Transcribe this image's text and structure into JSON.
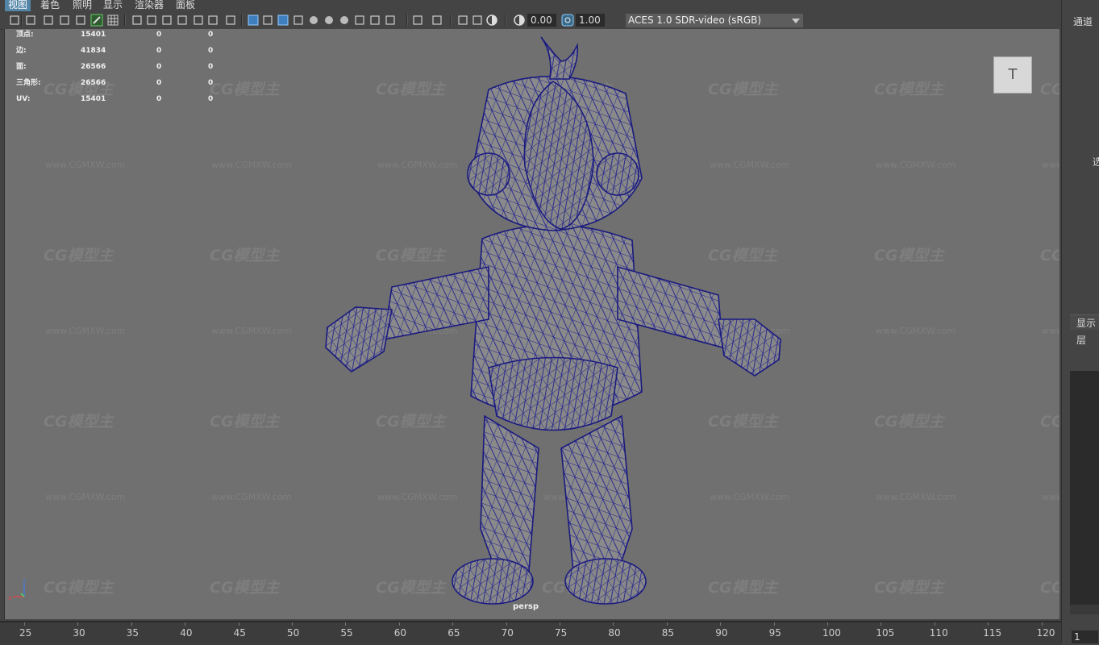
{
  "menu": {
    "items": [
      "视图",
      "着色",
      "照明",
      "显示",
      "渲染器",
      "面板"
    ],
    "active_index": 0
  },
  "toolbar": {
    "exposure_value": "0.00",
    "gamma_value": "1.00",
    "color_space": "ACES 1.0 SDR-video (sRGB)",
    "icons": [
      "camera-select-icon",
      "camera-attributes-icon",
      "bookmark-icon",
      "image-plane-icon",
      "2d-pan-zoom-icon",
      "grease-pencil-icon",
      "grid-icon",
      "film-gate-icon",
      "resolution-gate-icon",
      "gate-mask-icon",
      "field-chart-icon",
      "safe-action-icon",
      "safe-title-icon",
      "wireframe-icon",
      "smooth-shade-icon",
      "default-material-icon",
      "wireframe-on-shaded-icon",
      "xray-icon",
      "use-all-lights-icon",
      "shadows-icon",
      "ambient-occlusion-icon",
      "motion-blur-icon",
      "anti-aliasing-icon",
      "depth-of-field-icon",
      "isolate-select-icon",
      "xray-joints-icon",
      "xray-active-icon",
      "backface-culling-icon",
      "exposure-icon",
      "gamma-icon",
      "color-management-icon"
    ]
  },
  "hud": {
    "rows": [
      {
        "label": "顶点:",
        "value": "15401",
        "col2": "0",
        "col3": "0"
      },
      {
        "label": "边:",
        "value": "41834",
        "col2": "0",
        "col3": "0"
      },
      {
        "label": "面:",
        "value": "26566",
        "col2": "0",
        "col3": "0"
      },
      {
        "label": "三角形:",
        "value": "26566",
        "col2": "0",
        "col3": "0"
      },
      {
        "label": "UV:",
        "value": "15401",
        "col2": "0",
        "col3": "0"
      }
    ]
  },
  "viewport": {
    "camera_label": "persp",
    "viewcube_face": "T",
    "watermark_text": "CG模型主",
    "watermark_url": "www.CGMXW.com",
    "axis_labels": [
      "z",
      "x"
    ]
  },
  "right_panel": {
    "channels_label": "通道",
    "select_label": "选",
    "display_tab": "显示",
    "layers_label": "层"
  },
  "timeline": {
    "ticks": [
      "25",
      "30",
      "35",
      "40",
      "45",
      "50",
      "55",
      "60",
      "65",
      "70",
      "75",
      "80",
      "85",
      "90",
      "95",
      "100",
      "105",
      "110",
      "115",
      "120"
    ],
    "current_frame": "1"
  },
  "colors": {
    "viewport_bg": "#707070",
    "wire": "#1f1f8f",
    "mesh": "#8c8c8c",
    "accent": "#5285a6"
  }
}
